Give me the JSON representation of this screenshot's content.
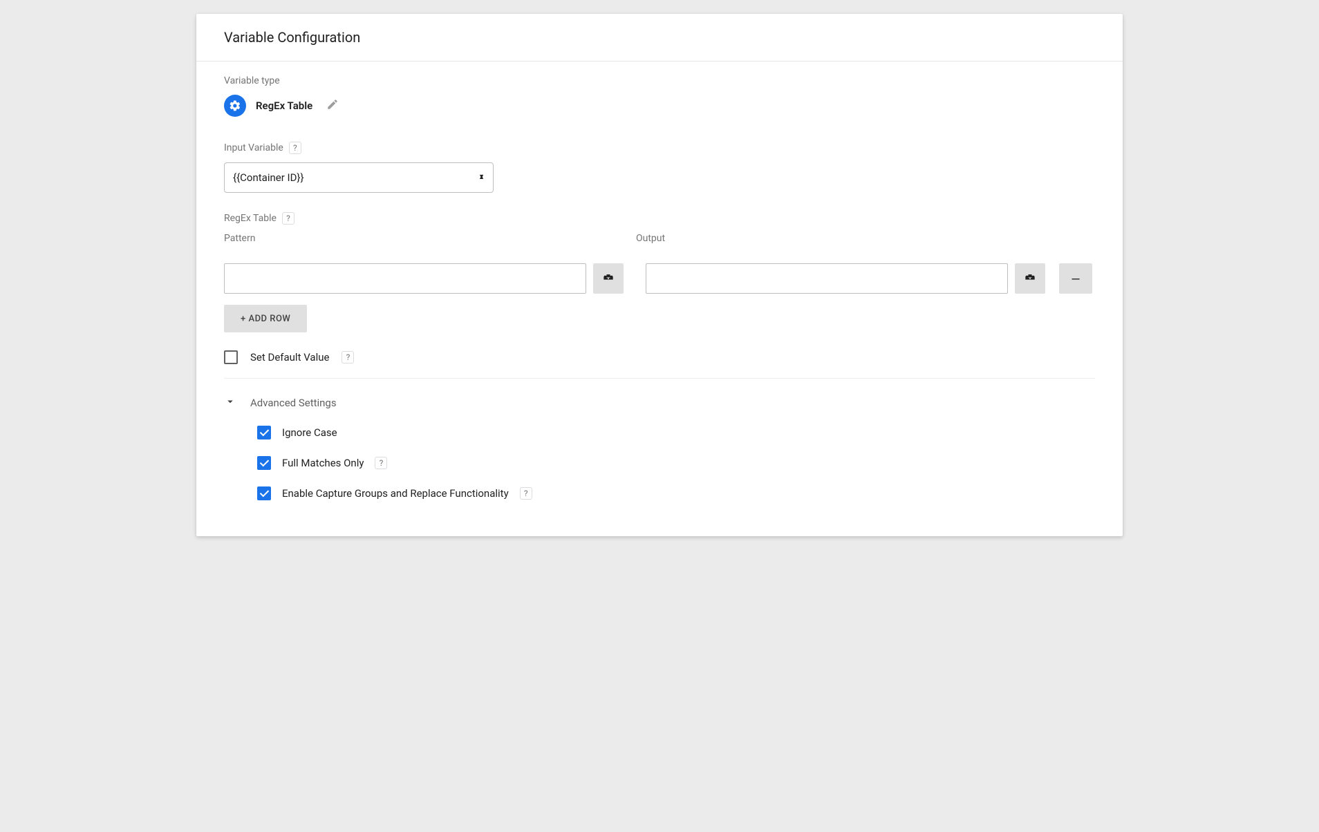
{
  "header": {
    "title": "Variable Configuration"
  },
  "variable_type": {
    "section_label": "Variable type",
    "name": "RegEx Table"
  },
  "input_variable": {
    "label": "Input Variable",
    "value": "{{Container ID}}"
  },
  "regex_table": {
    "label": "RegEx Table",
    "columns": {
      "pattern": "Pattern",
      "output": "Output"
    },
    "add_row_label": "+ ADD ROW",
    "remove_row_label": "–"
  },
  "default_value": {
    "label": "Set Default Value",
    "checked": false
  },
  "advanced": {
    "title": "Advanced Settings",
    "options": [
      {
        "label": "Ignore Case",
        "checked": true,
        "help": false
      },
      {
        "label": "Full Matches Only",
        "checked": true,
        "help": true
      },
      {
        "label": "Enable Capture Groups and Replace Functionality",
        "checked": true,
        "help": true
      }
    ]
  },
  "help_glyph": "?"
}
